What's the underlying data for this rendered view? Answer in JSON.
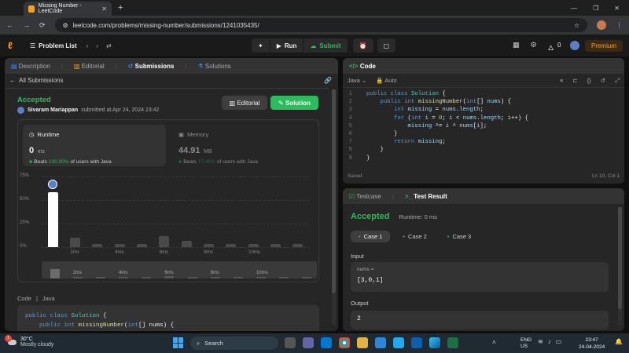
{
  "browser": {
    "tab_title": "Missing Number - LeetCode",
    "url": "leetcode.com/problems/missing-number/submissions/1241035435/"
  },
  "topnav": {
    "problem_list": "Problem List",
    "run": "Run",
    "submit": "Submit",
    "streak": "0",
    "premium": "Premium"
  },
  "left_tabs": [
    {
      "label": "Description"
    },
    {
      "label": "Editorial"
    },
    {
      "label": "Submissions"
    },
    {
      "label": "Solutions"
    }
  ],
  "back": "All Submissions",
  "result": {
    "status": "Accepted",
    "user": "Sivaram Mariappan",
    "submitted": "submitted at Apr 24, 2024 23:42",
    "editorial_btn": "Editorial",
    "solution_btn": "Solution"
  },
  "runtime": {
    "label": "Runtime",
    "value": "0",
    "unit": "ms",
    "beats_prefix": "Beats",
    "beats": "100.00%",
    "beats_suffix": "of users with Java"
  },
  "memory": {
    "label": "Memory",
    "value": "44.91",
    "unit": "MB",
    "beats_prefix": "Beats",
    "beats": "77.45%",
    "beats_suffix": "of users with Java"
  },
  "chart_data": {
    "type": "bar",
    "yticks": [
      "75%",
      "50%",
      "25%",
      "0%"
    ],
    "xticks": [
      "2ms",
      "4ms",
      "6ms",
      "8ms",
      "10ms"
    ],
    "values": [
      58,
      10,
      3,
      3,
      3,
      12,
      7,
      3,
      3,
      3,
      3,
      3
    ],
    "ylim": [
      0,
      75
    ],
    "highlight_index": 0
  },
  "code_label": "Code",
  "code_lang": "Java",
  "bottom_code": [
    "public class Solution {",
    "    public int missingNumber(int[] nums) {"
  ],
  "editor": {
    "title": "Code",
    "lang": "Java",
    "auto": "Auto",
    "status_left": "Saved",
    "status_right": "Ln 10, Col 1",
    "lines": [
      "public class Solution {",
      "    public int missingNumber(int[] nums) {",
      "        int missing = nums.length;",
      "        for (int i = 0; i < nums.length; i++) {",
      "            missing ^= i ^ nums[i];",
      "        }",
      "        return missing;",
      "    }",
      "}"
    ]
  },
  "test": {
    "tab1": "Testcase",
    "tab2": "Test Result",
    "status": "Accepted",
    "runtime": "Runtime: 0 ms",
    "cases": [
      "Case 1",
      "Case 2",
      "Case 3"
    ],
    "input_label": "Input",
    "param": "nums =",
    "input_value": "[3,0,1]",
    "output_label": "Output",
    "output_value": "2"
  },
  "taskbar": {
    "temp": "30°C",
    "weather": "Mostly cloudy",
    "search": "Search",
    "lang1": "ENG",
    "lang2": "US",
    "time": "23:47",
    "date": "24-04-2024",
    "badge": "1"
  }
}
